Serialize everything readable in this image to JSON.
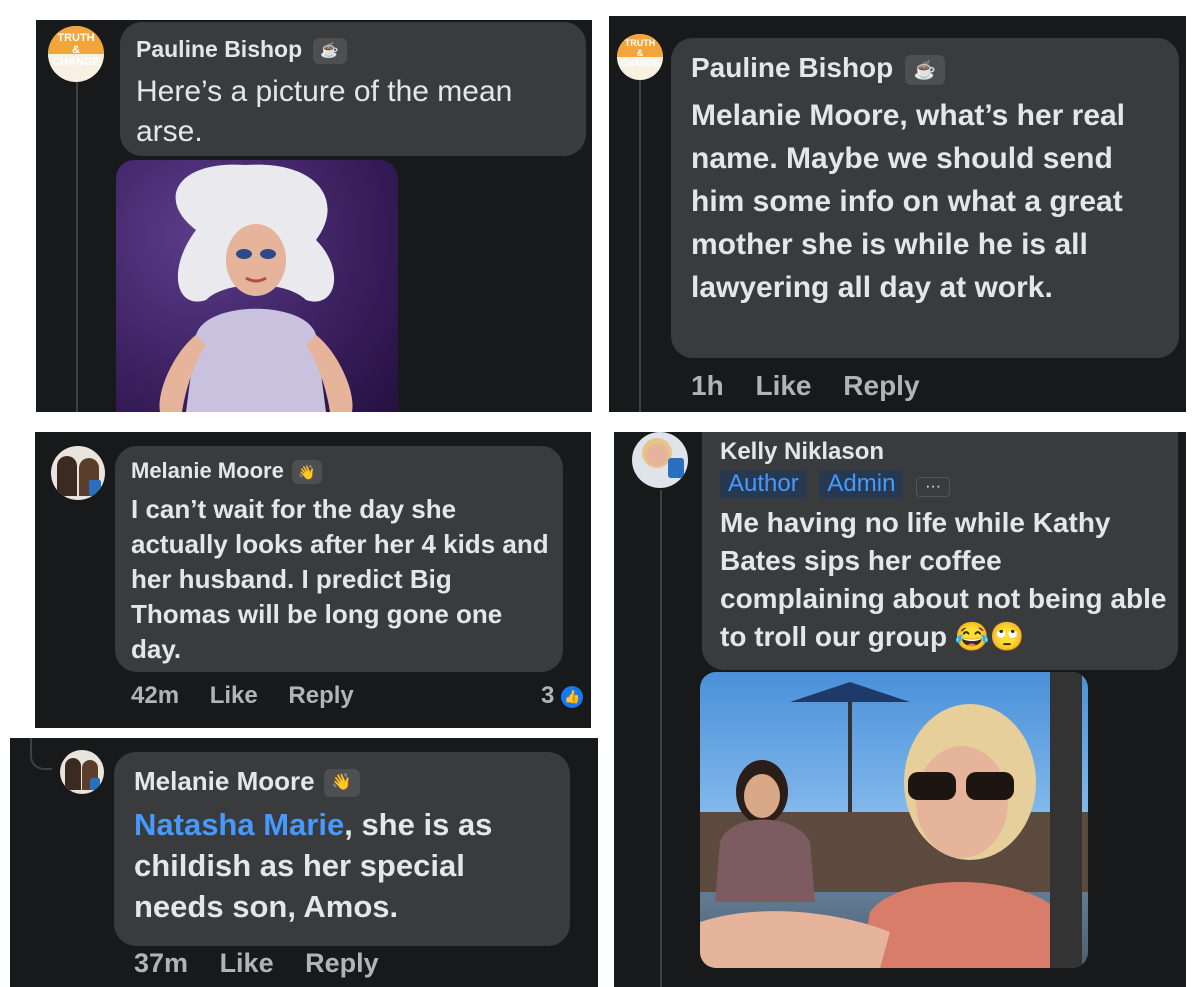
{
  "comments": [
    {
      "author": "Pauline Bishop",
      "avatar_text": [
        "TRUTH",
        "&",
        "CHANGE"
      ],
      "badge_icon": "coffee-cup-icon",
      "badge_glyph": "☕",
      "text": "Here’s a picture of the mean arse."
    },
    {
      "author": "Pauline Bishop",
      "avatar_text": [
        "TRUTH",
        "&",
        "CHANGE"
      ],
      "badge_icon": "coffee-cup-icon",
      "badge_glyph": "☕",
      "text": "Melanie Moore, what’s her real name. Maybe we should send him some info on what a great mother she is while he is all lawyering all day at work.",
      "time": "1h",
      "like": "Like",
      "reply": "Reply"
    },
    {
      "author": "Melanie Moore",
      "badge_icon": "waving-hand-icon",
      "badge_glyph": "👋",
      "text": "I can’t wait for the day she actually looks after her 4 kids and her husband. I predict Big Thomas will be long gone one day.",
      "time": "42m",
      "like": "Like",
      "reply": "Reply",
      "reactions": "3"
    },
    {
      "author": "Melanie Moore",
      "badge_icon": "waving-hand-icon",
      "badge_glyph": "👋",
      "mention": "Natasha Marie",
      "text": ", she is as childish as her special needs son, Amos.",
      "time": "37m",
      "like": "Like",
      "reply": "Reply"
    },
    {
      "author": "Kelly Niklason",
      "roles": [
        "Author",
        "Admin"
      ],
      "more": "···",
      "text": "Me having no life while Kathy Bates sips her coffee complaining about not being able to troll our group",
      "emoji": "😂🙄"
    }
  ],
  "colors": {
    "panel": "#18191a",
    "bubble": "#3a3b3c",
    "text": "#e4e6eb",
    "meta": "#b0b3b8",
    "link": "#4599ff",
    "like_badge": "#1877f2"
  }
}
